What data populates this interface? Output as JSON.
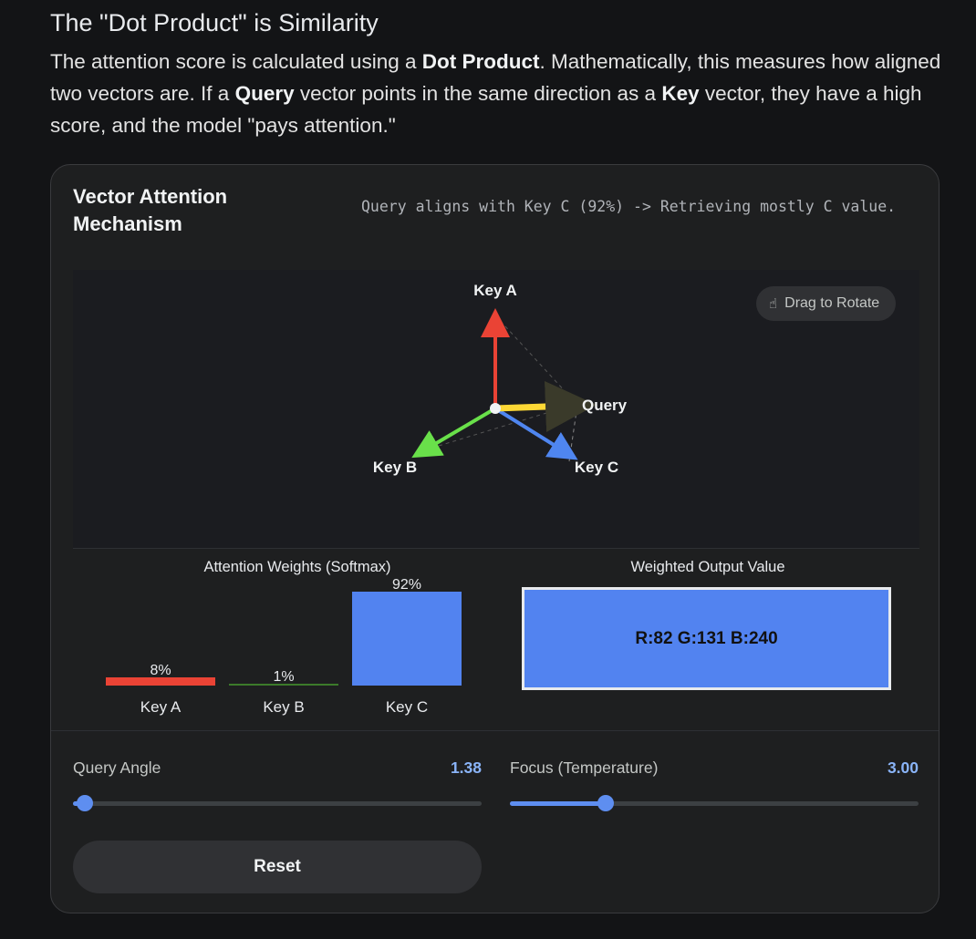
{
  "heading": "The \"Dot Product\" is Similarity",
  "intro": {
    "p1": "The attention score is calculated using a ",
    "b1": "Dot Product",
    "p2": ". Mathematically, this measures how aligned two vectors are. If a ",
    "b2": "Query",
    "p3": " vector points in the same direction as a ",
    "b3": "Key",
    "p4": " vector, they have a high score, and the model \"pays attention.\""
  },
  "card": {
    "title": "Vector Attention Mechanism",
    "status": "Query aligns with Key C (92%) -> Retrieving mostly C value."
  },
  "viz": {
    "drag_label": "Drag to Rotate",
    "drag_icon": "hand-pointer-icon",
    "vectors": [
      {
        "name": "Key A",
        "color": "#ea4335"
      },
      {
        "name": "Key B",
        "color": "#69e04a"
      },
      {
        "name": "Key C",
        "color": "#4f86f0"
      },
      {
        "name": "Query",
        "color": "#fdd835"
      }
    ]
  },
  "weights": {
    "title": "Attention Weights (Softmax)",
    "bars": [
      {
        "label": "Key A",
        "value": 8,
        "display": "8%",
        "color": "#ea4335"
      },
      {
        "label": "Key B",
        "value": 1,
        "display": "1%",
        "color": "#3c7a2a"
      },
      {
        "label": "Key C",
        "value": 92,
        "display": "92%",
        "color": "#5283f0"
      }
    ]
  },
  "output": {
    "title": "Weighted Output Value",
    "value": "R:82 G:131 B:240",
    "color": "#5283f0"
  },
  "sliders": {
    "query_angle": {
      "label": "Query Angle",
      "value": "1.38",
      "fraction": 0.03
    },
    "temperature": {
      "label": "Focus (Temperature)",
      "value": "3.00",
      "fraction": 0.235
    }
  },
  "reset_label": "Reset"
}
